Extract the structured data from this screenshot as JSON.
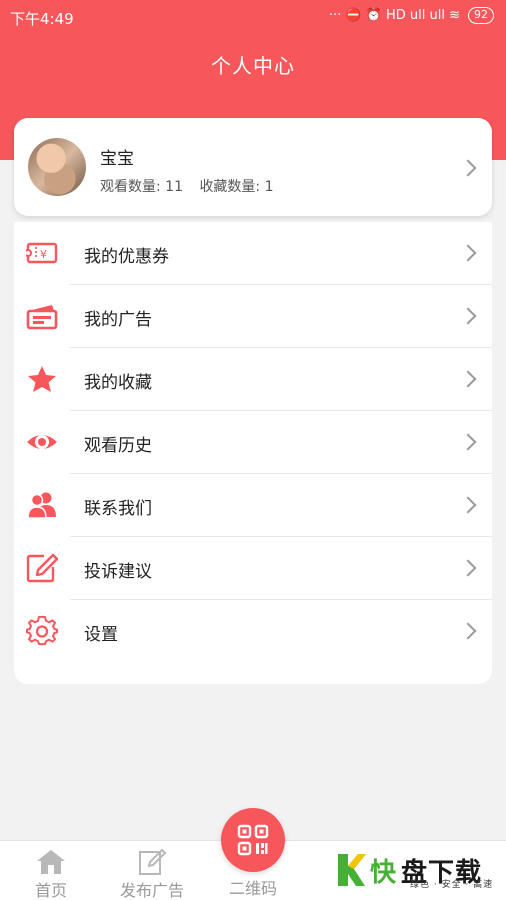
{
  "status_bar": {
    "time": "下午4:49",
    "indicators": "··· ⛔ ⏰ HD ull ull ≋",
    "battery": "92"
  },
  "header": {
    "title": "个人中心"
  },
  "profile": {
    "name": "宝宝",
    "views": "观看数量: 11",
    "favorites": "收藏数量: 1"
  },
  "menu": {
    "items": [
      {
        "label": "我的优惠券",
        "icon": "coupon-icon"
      },
      {
        "label": "我的广告",
        "icon": "ad-card-icon"
      },
      {
        "label": "我的收藏",
        "icon": "star-icon"
      },
      {
        "label": "观看历史",
        "icon": "eye-icon"
      },
      {
        "label": "联系我们",
        "icon": "contacts-icon"
      },
      {
        "label": "投诉建议",
        "icon": "edit-icon"
      },
      {
        "label": "设置",
        "icon": "gear-icon"
      }
    ]
  },
  "tabbar": {
    "home": "首页",
    "publish": "发布广告",
    "qrcode": "二维码"
  },
  "watermark": {
    "logo_char": "快",
    "brand": "盘下载",
    "tagline": "绿色 · 安全 · 高速"
  },
  "colors": {
    "accent": "#f7575b",
    "background": "#f2f2f2",
    "inactive_tab": "#999999",
    "watermark_green": "#45b035"
  }
}
